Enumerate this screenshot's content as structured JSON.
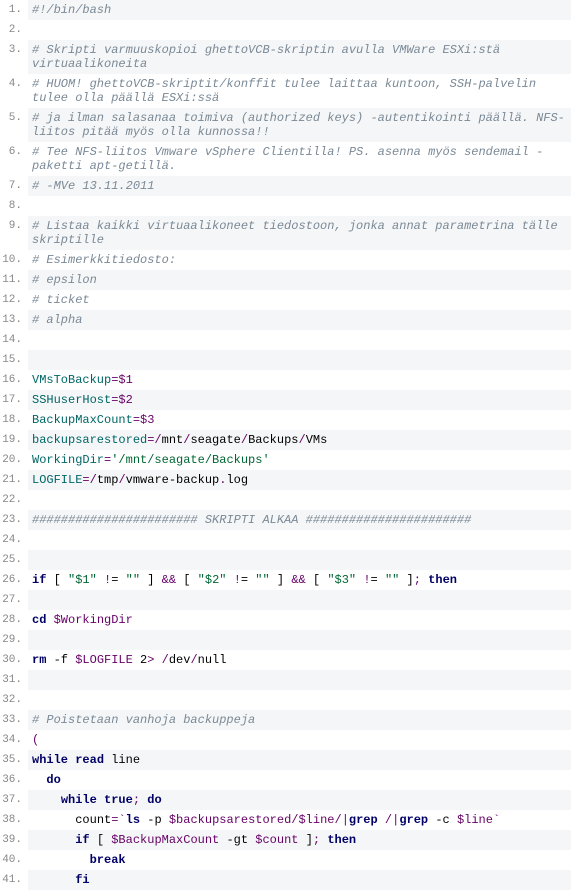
{
  "lines": [
    {
      "n": 1,
      "alt": true,
      "tokens": [
        {
          "t": "#!/bin/bash",
          "c": "cmt"
        }
      ]
    },
    {
      "n": 2,
      "alt": false,
      "tokens": []
    },
    {
      "n": 3,
      "alt": true,
      "tokens": [
        {
          "t": "# Skripti varmuuskopioi ghettoVCB-skriptin avulla VMWare ESXi:stä virtuaalikoneita",
          "c": "cmt"
        }
      ]
    },
    {
      "n": 4,
      "alt": false,
      "tokens": [
        {
          "t": "# HUOM! ghettoVCB-skriptit/konffit tulee laittaa kuntoon, SSH-palvelin tulee olla päällä ESXi:ssä",
          "c": "cmt"
        }
      ]
    },
    {
      "n": 5,
      "alt": true,
      "tokens": [
        {
          "t": "# ja ilman salasanaa toimiva (authorized keys) -autentikointi päällä. NFS-liitos pitää myös olla kunnossa!!",
          "c": "cmt"
        }
      ]
    },
    {
      "n": 6,
      "alt": false,
      "tokens": [
        {
          "t": "# Tee NFS-liitos Vmware vSphere Clientilla! PS. asenna myös sendemail -paketti apt-getillä.",
          "c": "cmt"
        }
      ]
    },
    {
      "n": 7,
      "alt": true,
      "tokens": [
        {
          "t": "# -MVe 13.11.2011",
          "c": "cmt"
        }
      ]
    },
    {
      "n": 8,
      "alt": false,
      "tokens": []
    },
    {
      "n": 9,
      "alt": true,
      "tokens": [
        {
          "t": "# Listaa kaikki virtuaalikoneet tiedostoon, jonka annat parametrina tälle skriptille",
          "c": "cmt"
        }
      ]
    },
    {
      "n": 10,
      "alt": false,
      "tokens": [
        {
          "t": "# Esimerkkitiedosto:",
          "c": "cmt"
        }
      ]
    },
    {
      "n": 11,
      "alt": true,
      "tokens": [
        {
          "t": "# epsilon",
          "c": "cmt"
        }
      ]
    },
    {
      "n": 12,
      "alt": false,
      "tokens": [
        {
          "t": "# ticket",
          "c": "cmt"
        }
      ]
    },
    {
      "n": 13,
      "alt": true,
      "tokens": [
        {
          "t": "# alpha",
          "c": "cmt"
        }
      ]
    },
    {
      "n": 14,
      "alt": false,
      "tokens": []
    },
    {
      "n": 15,
      "alt": true,
      "tokens": []
    },
    {
      "n": 16,
      "alt": false,
      "tokens": [
        {
          "t": "VMsToBackup",
          "c": "fn"
        },
        {
          "t": "=",
          "c": "op"
        },
        {
          "t": "$1",
          "c": "var"
        }
      ]
    },
    {
      "n": 17,
      "alt": true,
      "tokens": [
        {
          "t": "SSHuserHost",
          "c": "fn"
        },
        {
          "t": "=",
          "c": "op"
        },
        {
          "t": "$2",
          "c": "var"
        }
      ]
    },
    {
      "n": 18,
      "alt": false,
      "tokens": [
        {
          "t": "BackupMaxCount",
          "c": "fn"
        },
        {
          "t": "=",
          "c": "op"
        },
        {
          "t": "$3",
          "c": "var"
        }
      ]
    },
    {
      "n": 19,
      "alt": true,
      "tokens": [
        {
          "t": "backupsarestored",
          "c": "fn"
        },
        {
          "t": "=",
          "c": "op"
        },
        {
          "t": "/",
          "c": "punct"
        },
        {
          "t": "mnt",
          "c": "plain"
        },
        {
          "t": "/",
          "c": "punct"
        },
        {
          "t": "seagate",
          "c": "plain"
        },
        {
          "t": "/",
          "c": "punct"
        },
        {
          "t": "Backups",
          "c": "plain"
        },
        {
          "t": "/",
          "c": "punct"
        },
        {
          "t": "VMs",
          "c": "plain"
        }
      ]
    },
    {
      "n": 20,
      "alt": false,
      "tokens": [
        {
          "t": "WorkingDir",
          "c": "fn"
        },
        {
          "t": "=",
          "c": "op"
        },
        {
          "t": "'/mnt/seagate/Backups'",
          "c": "str"
        }
      ]
    },
    {
      "n": 21,
      "alt": true,
      "tokens": [
        {
          "t": "LOGFILE",
          "c": "fn"
        },
        {
          "t": "=",
          "c": "op"
        },
        {
          "t": "/",
          "c": "punct"
        },
        {
          "t": "tmp",
          "c": "plain"
        },
        {
          "t": "/",
          "c": "punct"
        },
        {
          "t": "vmware-backup",
          "c": "plain"
        },
        {
          "t": ".",
          "c": "dot"
        },
        {
          "t": "log",
          "c": "plain"
        }
      ]
    },
    {
      "n": 22,
      "alt": false,
      "tokens": []
    },
    {
      "n": 23,
      "alt": true,
      "tokens": [
        {
          "t": "####################### SKRIPTI ALKAA #######################",
          "c": "cmt"
        }
      ]
    },
    {
      "n": 24,
      "alt": false,
      "tokens": []
    },
    {
      "n": 25,
      "alt": true,
      "tokens": []
    },
    {
      "n": 26,
      "alt": false,
      "tokens": [
        {
          "t": "if",
          "c": "kw"
        },
        {
          "t": " [ ",
          "c": "plain"
        },
        {
          "t": "\"$1\"",
          "c": "str"
        },
        {
          "t": " ",
          "c": "plain"
        },
        {
          "t": "!",
          "c": "op"
        },
        {
          "t": "= ",
          "c": "plain"
        },
        {
          "t": "\"\"",
          "c": "str"
        },
        {
          "t": " ] ",
          "c": "plain"
        },
        {
          "t": "&&",
          "c": "op"
        },
        {
          "t": " [ ",
          "c": "plain"
        },
        {
          "t": "\"$2\"",
          "c": "str"
        },
        {
          "t": " ",
          "c": "plain"
        },
        {
          "t": "!",
          "c": "op"
        },
        {
          "t": "= ",
          "c": "plain"
        },
        {
          "t": "\"\"",
          "c": "str"
        },
        {
          "t": " ] ",
          "c": "plain"
        },
        {
          "t": "&&",
          "c": "op"
        },
        {
          "t": " [ ",
          "c": "plain"
        },
        {
          "t": "\"$3\"",
          "c": "str"
        },
        {
          "t": " ",
          "c": "plain"
        },
        {
          "t": "!",
          "c": "op"
        },
        {
          "t": "= ",
          "c": "plain"
        },
        {
          "t": "\"\"",
          "c": "str"
        },
        {
          "t": " ]",
          "c": "plain"
        },
        {
          "t": ";",
          "c": "op"
        },
        {
          "t": " ",
          "c": "plain"
        },
        {
          "t": "then",
          "c": "kw"
        }
      ]
    },
    {
      "n": 27,
      "alt": true,
      "tokens": []
    },
    {
      "n": 28,
      "alt": false,
      "tokens": [
        {
          "t": "cd",
          "c": "kw"
        },
        {
          "t": " ",
          "c": "plain"
        },
        {
          "t": "$WorkingDir",
          "c": "var"
        }
      ]
    },
    {
      "n": 29,
      "alt": true,
      "tokens": []
    },
    {
      "n": 30,
      "alt": false,
      "tokens": [
        {
          "t": "rm",
          "c": "kw"
        },
        {
          "t": " -f ",
          "c": "plain"
        },
        {
          "t": "$LOGFILE",
          "c": "var"
        },
        {
          "t": " 2",
          "c": "plain"
        },
        {
          "t": ">",
          "c": "op"
        },
        {
          "t": " ",
          "c": "plain"
        },
        {
          "t": "/",
          "c": "punct"
        },
        {
          "t": "dev",
          "c": "plain"
        },
        {
          "t": "/",
          "c": "punct"
        },
        {
          "t": "null",
          "c": "plain"
        }
      ]
    },
    {
      "n": 31,
      "alt": true,
      "tokens": []
    },
    {
      "n": 32,
      "alt": false,
      "tokens": []
    },
    {
      "n": 33,
      "alt": true,
      "tokens": [
        {
          "t": "# Poistetaan vanhoja backuppeja",
          "c": "cmt"
        }
      ]
    },
    {
      "n": 34,
      "alt": false,
      "tokens": [
        {
          "t": "(",
          "c": "punct"
        }
      ]
    },
    {
      "n": 35,
      "alt": true,
      "tokens": [
        {
          "t": "while",
          "c": "kw"
        },
        {
          "t": " ",
          "c": "plain"
        },
        {
          "t": "read",
          "c": "kw"
        },
        {
          "t": " line",
          "c": "plain"
        }
      ]
    },
    {
      "n": 36,
      "alt": false,
      "tokens": [
        {
          "t": "  ",
          "c": "plain"
        },
        {
          "t": "do",
          "c": "kw"
        }
      ]
    },
    {
      "n": 37,
      "alt": true,
      "tokens": [
        {
          "t": "    ",
          "c": "plain"
        },
        {
          "t": "while",
          "c": "kw"
        },
        {
          "t": " ",
          "c": "plain"
        },
        {
          "t": "true",
          "c": "kw"
        },
        {
          "t": ";",
          "c": "op"
        },
        {
          "t": " ",
          "c": "plain"
        },
        {
          "t": "do",
          "c": "kw"
        }
      ]
    },
    {
      "n": 38,
      "alt": false,
      "tokens": [
        {
          "t": "      count",
          "c": "plain"
        },
        {
          "t": "=",
          "c": "op"
        },
        {
          "t": "`",
          "c": "op"
        },
        {
          "t": "ls",
          "c": "kw"
        },
        {
          "t": " -p ",
          "c": "plain"
        },
        {
          "t": "$backupsarestored",
          "c": "var"
        },
        {
          "t": "/",
          "c": "punct"
        },
        {
          "t": "$line",
          "c": "var"
        },
        {
          "t": "/",
          "c": "punct"
        },
        {
          "t": "|",
          "c": "op"
        },
        {
          "t": "grep",
          "c": "kw"
        },
        {
          "t": " ",
          "c": "plain"
        },
        {
          "t": "/",
          "c": "punct"
        },
        {
          "t": "|",
          "c": "op"
        },
        {
          "t": "grep",
          "c": "kw"
        },
        {
          "t": " -c ",
          "c": "plain"
        },
        {
          "t": "$line",
          "c": "var"
        },
        {
          "t": "`",
          "c": "op"
        }
      ]
    },
    {
      "n": 39,
      "alt": true,
      "tokens": [
        {
          "t": "      ",
          "c": "plain"
        },
        {
          "t": "if",
          "c": "kw"
        },
        {
          "t": " [ ",
          "c": "plain"
        },
        {
          "t": "$BackupMaxCount",
          "c": "var"
        },
        {
          "t": " -gt ",
          "c": "plain"
        },
        {
          "t": "$count",
          "c": "var"
        },
        {
          "t": " ]",
          "c": "plain"
        },
        {
          "t": ";",
          "c": "op"
        },
        {
          "t": " ",
          "c": "plain"
        },
        {
          "t": "then",
          "c": "kw"
        }
      ]
    },
    {
      "n": 40,
      "alt": false,
      "tokens": [
        {
          "t": "        ",
          "c": "plain"
        },
        {
          "t": "break",
          "c": "kw"
        }
      ]
    },
    {
      "n": 41,
      "alt": true,
      "tokens": [
        {
          "t": "      ",
          "c": "plain"
        },
        {
          "t": "fi",
          "c": "kw"
        }
      ]
    }
  ]
}
